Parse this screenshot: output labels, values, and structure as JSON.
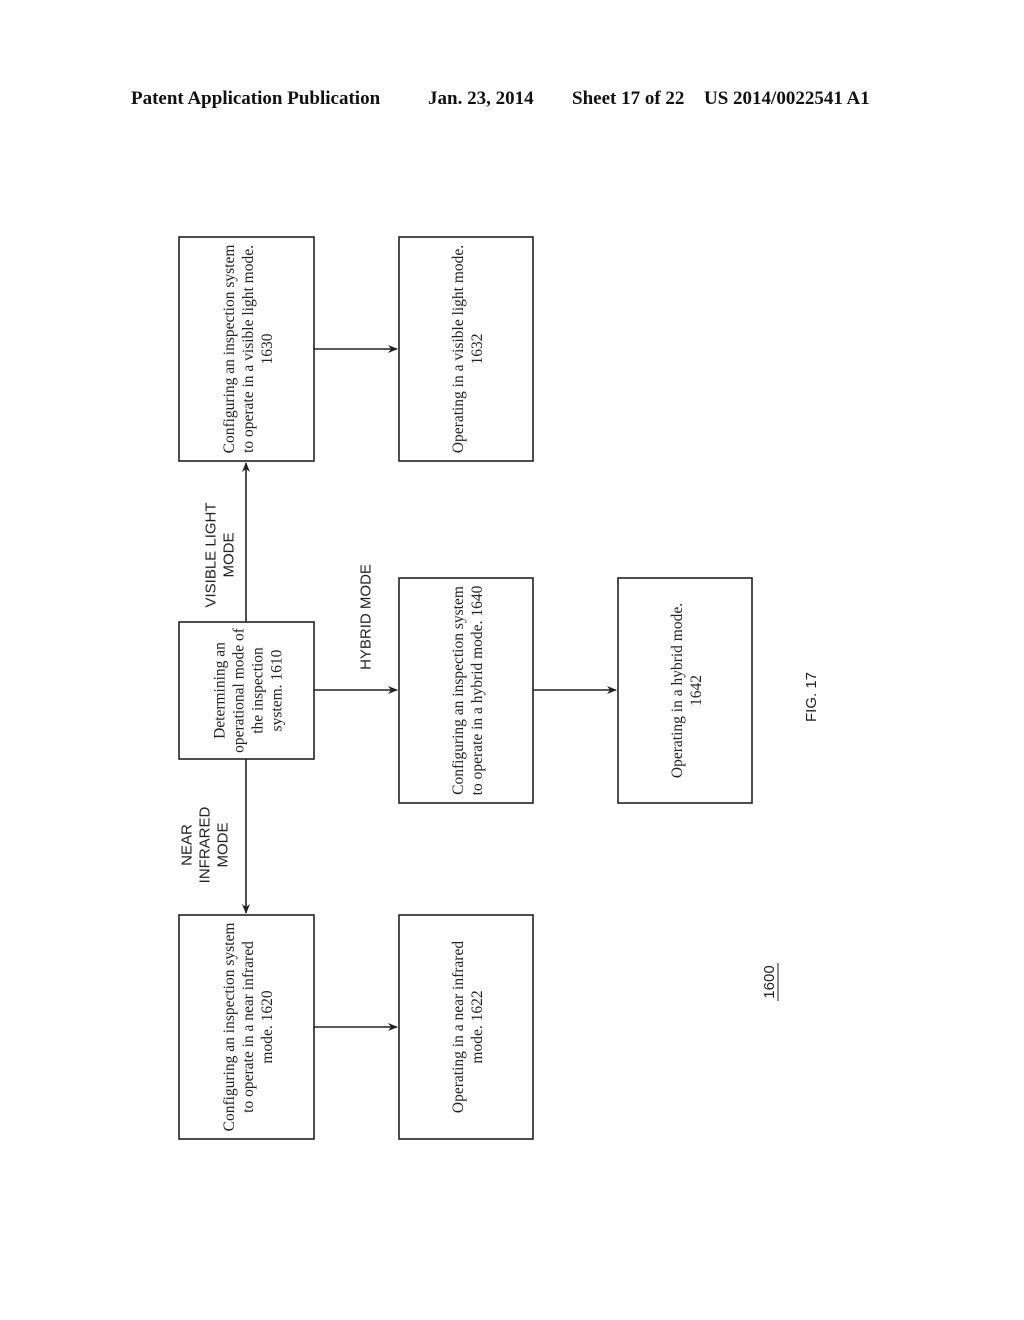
{
  "header": {
    "publication": "Patent Application Publication",
    "date": "Jan. 23, 2014",
    "sheet": "Sheet 17 of 22",
    "number": "US 2014/0022541 A1"
  },
  "diagram": {
    "reference": "1600",
    "figure_label": "FIG. 17",
    "boxes": {
      "b1610": {
        "lines": [
          "Determining an",
          "operational mode of",
          "the inspection",
          "system. 1610"
        ]
      },
      "b1630": {
        "lines": [
          "Configuring an inspection system",
          "to operate in a visible light mode.",
          "1630"
        ]
      },
      "b1632": {
        "lines": [
          "Operating in a visible light mode.",
          "1632"
        ]
      },
      "b1640": {
        "lines": [
          "Configuring an inspection system",
          "to operate in a hybrid mode. 1640"
        ]
      },
      "b1642": {
        "lines": [
          "Operating in a hybrid mode.",
          "1642"
        ]
      },
      "b1620": {
        "lines": [
          "Configuring an inspection system",
          "to operate in a near infrared",
          "mode. 1620"
        ]
      },
      "b1622": {
        "lines": [
          "Operating in a near infrared",
          "mode. 1622"
        ]
      }
    },
    "branch_labels": {
      "visible": [
        "VISIBLE LIGHT",
        "MODE"
      ],
      "hybrid": [
        "HYBRID MODE"
      ],
      "near_infrared": [
        "NEAR",
        "INFRARED",
        "MODE"
      ]
    }
  }
}
